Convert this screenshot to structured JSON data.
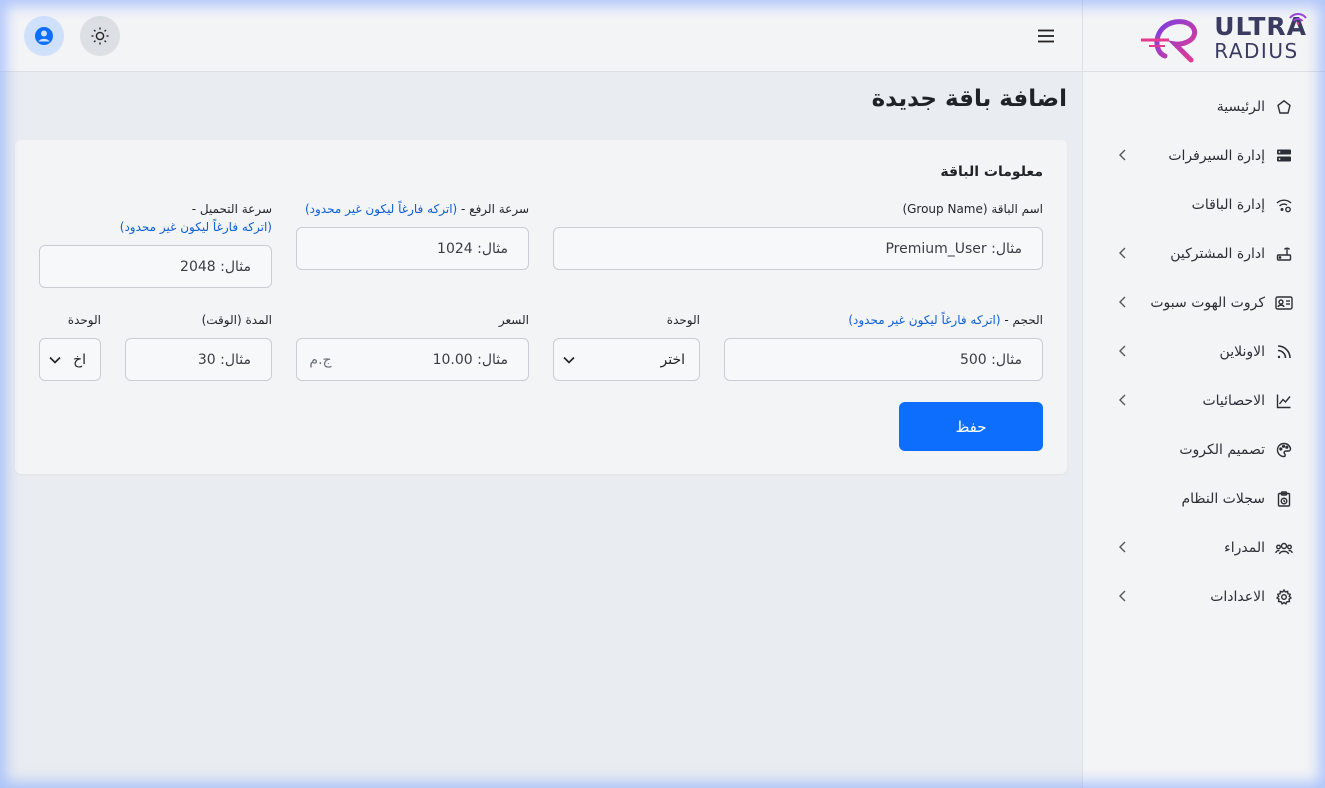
{
  "brand": {
    "line1": "ULTRA",
    "line2": "RADIUS"
  },
  "sidebar": {
    "items": [
      {
        "label": "الرئيسية",
        "icon": "home-icon",
        "has_submenu": false
      },
      {
        "label": "إدارة السيرفرات",
        "icon": "server-icon",
        "has_submenu": true
      },
      {
        "label": "إدارة الباقات",
        "icon": "wifi-gear-icon",
        "has_submenu": false
      },
      {
        "label": "ادارة المشتركين",
        "icon": "router-icon",
        "has_submenu": true
      },
      {
        "label": "كروت الهوت سبوت",
        "icon": "id-card-icon",
        "has_submenu": true
      },
      {
        "label": "الاونلاين",
        "icon": "rss-icon",
        "has_submenu": true
      },
      {
        "label": "الاحصائيات",
        "icon": "chart-line-icon",
        "has_submenu": true
      },
      {
        "label": "تصميم الكروت",
        "icon": "palette-icon",
        "has_submenu": false
      },
      {
        "label": "سجلات النظام",
        "icon": "clipboard-clock-icon",
        "has_submenu": false
      },
      {
        "label": "المدراء",
        "icon": "users-icon",
        "has_submenu": true
      },
      {
        "label": "الاعدادات",
        "icon": "gear-icon",
        "has_submenu": true
      }
    ]
  },
  "page": {
    "title": "اضافة باقة جديدة"
  },
  "form": {
    "section_title": "معلومات الباقة",
    "group_name": {
      "label": "اسم الباقة (Group Name)",
      "placeholder": "مثال: Premium_User"
    },
    "upload_speed": {
      "label": "سرعة الرفع - ",
      "hint": "(اتركه فارغاً ليكون غير محدود)",
      "placeholder": "مثال: 1024"
    },
    "download_speed": {
      "label": "سرعة التحميل - ",
      "hint": "(اتركه فارغاً ليكون غير محدود)",
      "placeholder": "مثال: 2048"
    },
    "size": {
      "label": "الحجم - ",
      "hint": "(اتركه فارغاً ليكون غير محدود)",
      "placeholder": "مثال: 500"
    },
    "size_unit": {
      "label": "الوحدة",
      "value": "اختر"
    },
    "price": {
      "label": "السعر",
      "placeholder": "مثال: 10.00",
      "currency": "ج.م"
    },
    "duration": {
      "label": "المدة (الوقت)",
      "placeholder": "مثال: 30"
    },
    "duration_unit": {
      "label": "الوحدة",
      "value": "اخ"
    },
    "save_label": "حفظ"
  },
  "colors": {
    "primary": "#0d6efd",
    "hint": "#0d5fd8"
  }
}
